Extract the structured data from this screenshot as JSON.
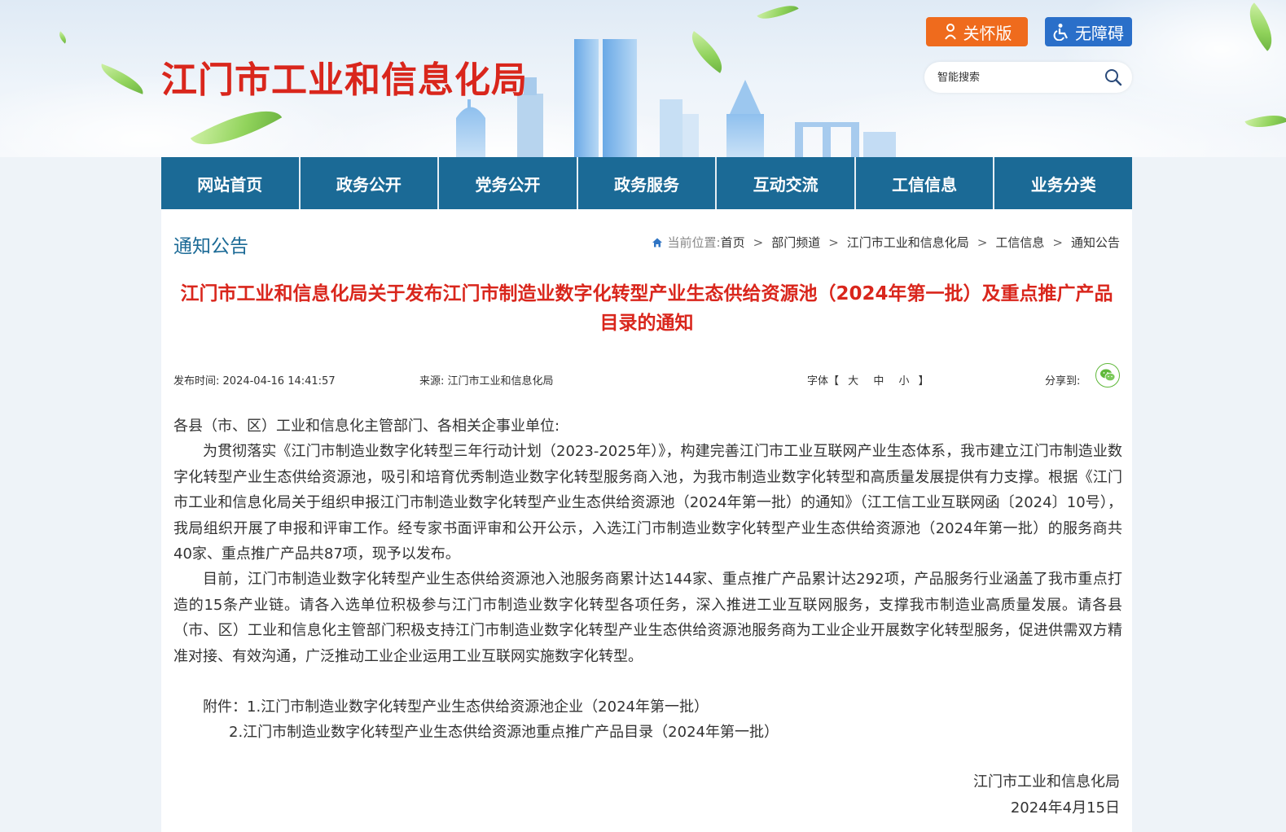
{
  "header": {
    "site_title": "江门市工业和信息化局",
    "care_mode_label": "关怀版",
    "accessibility_label": "无障碍",
    "search_placeholder": "智能搜索"
  },
  "nav": {
    "items": [
      "网站首页",
      "政务公开",
      "党务公开",
      "政务服务",
      "互动交流",
      "工信信息",
      "业务分类"
    ]
  },
  "page": {
    "section_title": "通知公告",
    "breadcrumb": {
      "location_label": "当前位置:",
      "items": [
        "首页",
        "部门频道",
        "江门市工业和信息化局",
        "工信信息",
        "通知公告"
      ],
      "separator": ">"
    }
  },
  "article": {
    "title": "江门市工业和信息化局关于发布江门市制造业数字化转型产业生态供给资源池（2024年第一批）及重点推广产品目录的通知",
    "publish_label": "发布时间:",
    "publish_time": "2024-04-16 14:41:57",
    "source_label": "来源:",
    "source": "江门市工业和信息化局",
    "font_label": "字体【",
    "font_large": "大",
    "font_medium": "中",
    "font_small": "小",
    "font_end": "】",
    "share_label": "分享到:",
    "salutation": "各县（市、区）工业和信息化主管部门、各相关企事业单位:",
    "paragraph1": "为贯彻落实《江门市制造业数字化转型三年行动计划（2023-2025年）》，构建完善江门市工业互联网产业生态体系，我市建立江门市制造业数字化转型产业生态供给资源池，吸引和培育优秀制造业数字化转型服务商入池，为我市制造业数字化转型和高质量发展提供有力支撑。根据《江门市工业和信息化局关于组织申报江门市制造业数字化转型产业生态供给资源池（2024年第一批）的通知》（江工信工业互联网函〔2024〕10号），我局组织开展了申报和评审工作。经专家书面评审和公开公示，入选江门市制造业数字化转型产业生态供给资源池（2024年第一批）的服务商共40家、重点推广产品共87项，现予以发布。",
    "paragraph2": "目前，江门市制造业数字化转型产业生态供给资源池入池服务商累计达144家、重点推广产品累计达292项，产品服务行业涵盖了我市重点打造的15条产业链。请各入选单位积极参与江门市制造业数字化转型各项任务，深入推进工业互联网服务，支撑我市制造业高质量发展。请各县（市、区）工业和信息化主管部门积极支持江门市制造业数字化转型产业生态供给资源池服务商为工业企业开展数字化转型服务，促进供需双方精准对接、有效沟通，广泛推动工业企业运用工业互联网实施数字化转型。",
    "attachment1": "附件：1.江门市制造业数字化转型产业生态供给资源池企业（2024年第一批）",
    "attachment2": "2.江门市制造业数字化转型产业生态供给资源池重点推广产品目录（2024年第一批）",
    "signature_org": "江门市工业和信息化局",
    "signature_date": "2024年4月15日"
  },
  "colors": {
    "title_red": "#d9261c",
    "nav_blue": "#1b6a96",
    "care_orange": "#ef6b1d",
    "access_blue": "#2a6fc9",
    "wechat_green": "#5fb83a"
  }
}
